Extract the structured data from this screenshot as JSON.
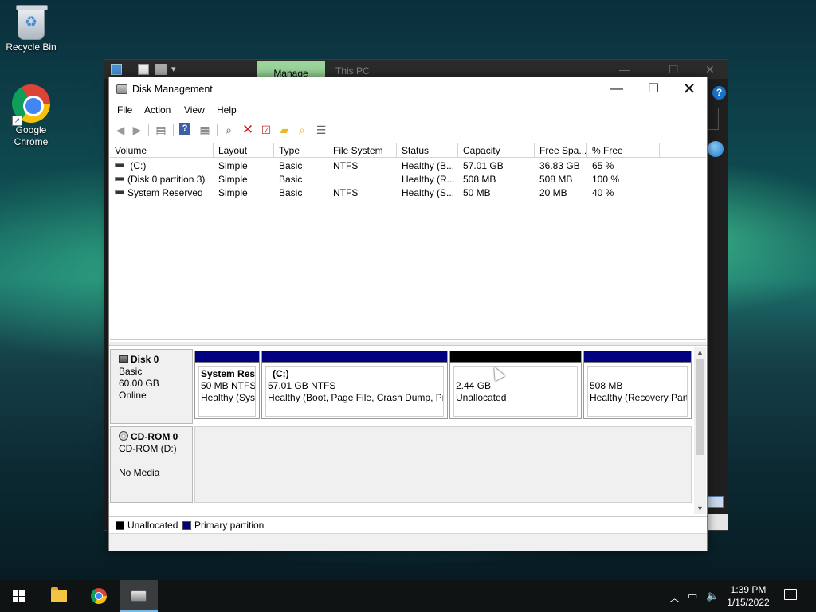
{
  "desktop": {
    "icons": [
      {
        "label": "Recycle Bin",
        "icon": "recycle-bin-icon"
      },
      {
        "label": "Google Chrome",
        "icon": "chrome-icon"
      }
    ]
  },
  "explorer": {
    "ribbon_tab": "Manage",
    "title": "This PC"
  },
  "window": {
    "title": "Disk Management",
    "minimize": "—",
    "maximize": "☐",
    "close": "✕"
  },
  "menu": [
    "File",
    "Action",
    "View",
    "Help"
  ],
  "toolbar": {
    "icons": [
      "back-icon",
      "forward-icon",
      "properties-icon",
      "help-icon",
      "show-hide-icon",
      "connect-icon",
      "delete-icon",
      "check-icon",
      "folder-up-icon",
      "search-icon",
      "settings-icon"
    ]
  },
  "volumes": {
    "columns": [
      "Volume",
      "Layout",
      "Type",
      "File System",
      "Status",
      "Capacity",
      "Free Spa...",
      "% Free"
    ],
    "rows": [
      {
        "volume": "(C:)",
        "layout": "Simple",
        "type": "Basic",
        "fs": "NTFS",
        "status": "Healthy (B...",
        "capacity": "57.01 GB",
        "free": "36.83 GB",
        "pct": "65 %"
      },
      {
        "volume": "(Disk 0 partition 3)",
        "layout": "Simple",
        "type": "Basic",
        "fs": "",
        "status": "Healthy (R...",
        "capacity": "508 MB",
        "free": "508 MB",
        "pct": "100 %"
      },
      {
        "volume": "System Reserved",
        "layout": "Simple",
        "type": "Basic",
        "fs": "NTFS",
        "status": "Healthy (S...",
        "capacity": "50 MB",
        "free": "20 MB",
        "pct": "40 %"
      }
    ]
  },
  "disks": [
    {
      "name": "Disk 0",
      "kind": "Basic",
      "size": "60.00 GB",
      "state": "Online",
      "partitions": [
        {
          "title": "System Rese",
          "line1": "50 MB NTFS",
          "line2": "Healthy (Syst",
          "type": "primary"
        },
        {
          "title": "(C:)",
          "line1": "57.01 GB NTFS",
          "line2": "Healthy (Boot, Page File, Crash Dump, Pri",
          "type": "primary"
        },
        {
          "title": "",
          "line1": "2.44 GB",
          "line2": "Unallocated",
          "type": "unallocated"
        },
        {
          "title": "",
          "line1": "508 MB",
          "line2": "Healthy (Recovery Part",
          "type": "primary"
        }
      ]
    },
    {
      "name": "CD-ROM 0",
      "kind": "CD-ROM (D:)",
      "size": "",
      "state": "No Media"
    }
  ],
  "legend": [
    {
      "label": "Unallocated",
      "color": "#000000"
    },
    {
      "label": "Primary partition",
      "color": "#000080"
    }
  ],
  "taskbar": {
    "time": "1:39 PM",
    "date": "1/15/2022"
  }
}
